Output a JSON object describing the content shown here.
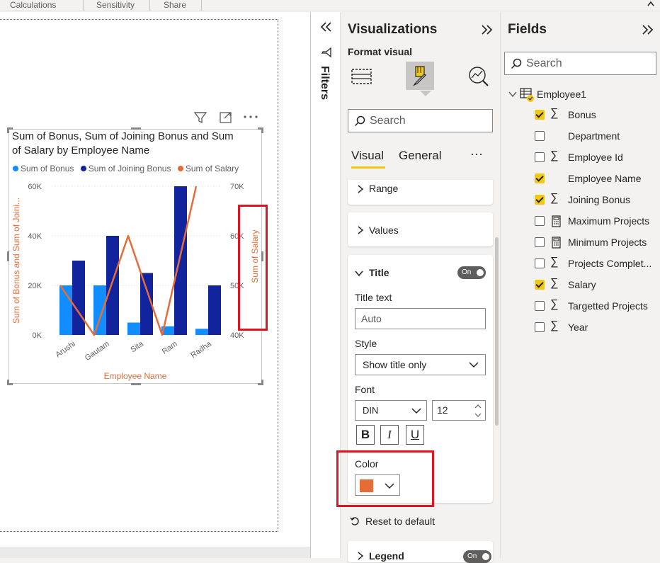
{
  "ribbon": {
    "tabs": [
      "Calculations",
      "Sensitivity",
      "Share"
    ]
  },
  "chart": {
    "title_line1": "Sum of Bonus, Sum of Joining Bonus and Sum",
    "title_line2": "of Salary by Employee Name",
    "legend": [
      "Sum of Bonus",
      "Sum of Joining Bonus",
      "Sum of Salary"
    ],
    "colors": {
      "bonus": "#118dff",
      "joining": "#12239e",
      "salary": "#e66c37"
    },
    "ylabel_left": "Sum of Bonus and Sum of Joini...",
    "ylabel_right": "Sum of Salary",
    "xlabel": "Employee Name",
    "left_ticks": [
      "60K",
      "40K",
      "20K",
      "0K"
    ],
    "right_ticks": [
      "70K",
      "60K",
      "50K",
      "40K"
    ]
  },
  "chart_data": {
    "type": "bar",
    "categories": [
      "Arushi",
      "Gautam",
      "Sita",
      "Ram",
      "Radha"
    ],
    "series": [
      {
        "name": "Sum of Bonus",
        "values": [
          20000,
          20000,
          5000,
          3500,
          2500
        ],
        "axis": "left",
        "kind": "bar"
      },
      {
        "name": "Sum of Joining Bonus",
        "values": [
          30000,
          40000,
          25000,
          60000,
          20000
        ],
        "axis": "left",
        "kind": "bar"
      },
      {
        "name": "Sum of Salary",
        "values": [
          50000,
          40000,
          60000,
          40000,
          70000
        ],
        "axis": "right",
        "kind": "line"
      }
    ],
    "title": "Sum of Bonus, Sum of Joining Bonus and Sum of Salary by Employee Name",
    "xlabel": "Employee Name",
    "ylabel": "Sum of Bonus and Sum of Joini...",
    "y2label": "Sum of Salary",
    "ylim": [
      0,
      60000
    ],
    "y2lim": [
      40000,
      70000
    ],
    "grid": true,
    "legend_position": "top-left"
  },
  "filters": {
    "label": "Filters"
  },
  "viz": {
    "title": "Visualizations",
    "subtitle": "Format visual",
    "search_placeholder": "Search",
    "tabs": [
      "Visual",
      "General"
    ],
    "more": "···",
    "sections": {
      "range": "Range",
      "values": "Values",
      "title": "Title",
      "legend": "Legend"
    },
    "title_toggle": "On",
    "legend_toggle": "On",
    "title_text_label": "Title text",
    "title_text_value": "Auto",
    "style_label": "Style",
    "style_value": "Show title only",
    "font_label": "Font",
    "font_value": "DIN",
    "font_size": "12",
    "bold": "B",
    "italic": "I",
    "underline": "U",
    "color_label": "Color",
    "color_value": "#e66c37",
    "reset": "Reset to default"
  },
  "fields": {
    "title": "Fields",
    "search_placeholder": "Search",
    "table": "Employee1",
    "items": [
      {
        "label": "Bonus",
        "checked": true,
        "icon": "sigma"
      },
      {
        "label": "Department",
        "checked": false,
        "icon": ""
      },
      {
        "label": "Employee Id",
        "checked": false,
        "icon": "sigma"
      },
      {
        "label": "Employee Name",
        "checked": true,
        "icon": ""
      },
      {
        "label": "Joining Bonus",
        "checked": true,
        "icon": "sigma"
      },
      {
        "label": "Maximum Projects",
        "checked": false,
        "icon": "calculator"
      },
      {
        "label": "Minimum Projects",
        "checked": false,
        "icon": "calculator"
      },
      {
        "label": "Projects Complet...",
        "checked": false,
        "icon": "sigma"
      },
      {
        "label": "Salary",
        "checked": true,
        "icon": "sigma"
      },
      {
        "label": "Targetted Projects",
        "checked": false,
        "icon": "sigma"
      },
      {
        "label": "Year",
        "checked": false,
        "icon": "sigma"
      }
    ]
  }
}
